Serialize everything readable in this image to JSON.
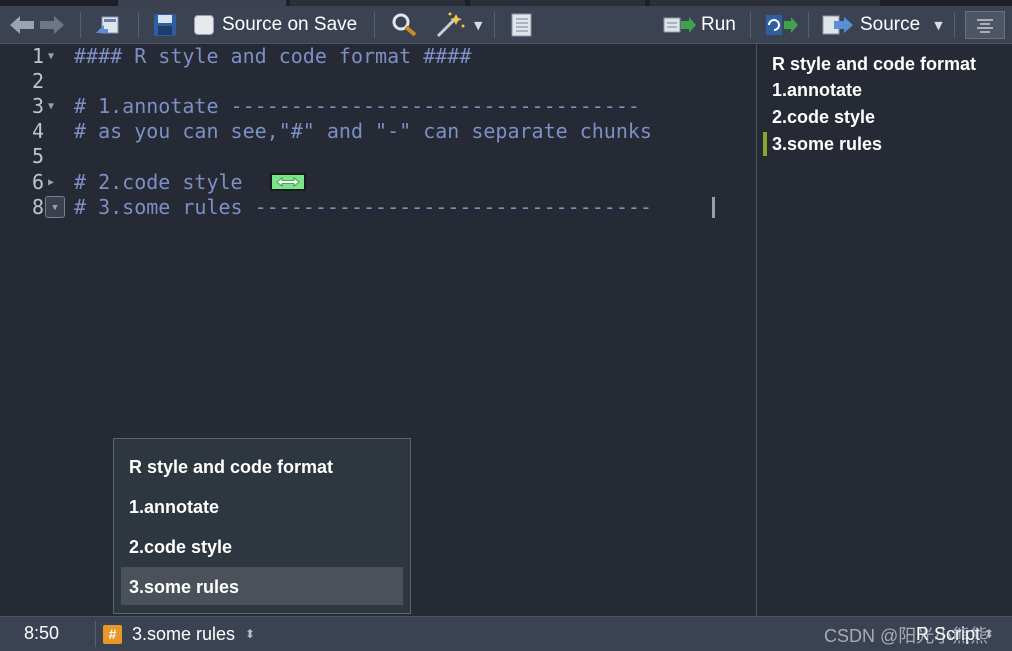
{
  "toolbar": {
    "back_icon": "arrow-left-icon",
    "forward_icon": "arrow-right-icon",
    "source_on_save_label": "Source on Save",
    "run_label": "Run",
    "source_label": "Source"
  },
  "editor": {
    "lines": [
      {
        "num": "1",
        "text": "#### R style and code format ####",
        "fold": "expanded"
      },
      {
        "num": "2",
        "text": "",
        "fold": ""
      },
      {
        "num": "3",
        "text": "# 1.annotate ----------------------------------",
        "fold": "expanded"
      },
      {
        "num": "4",
        "text": "# as you can see,\"#\" and \"-\" can separate chunks",
        "fold": ""
      },
      {
        "num": "5",
        "text": "",
        "fold": ""
      },
      {
        "num": "6",
        "text": "# 2.code style",
        "fold": "collapsed"
      },
      {
        "num": "8",
        "text": "# 3.some rules ---------------------------------",
        "fold": "active"
      }
    ]
  },
  "outline": {
    "items": [
      "R style and code format",
      "1.annotate",
      "2.code style",
      "3.some rules"
    ]
  },
  "popup": {
    "items": [
      "R style and code format",
      "1.annotate",
      "2.code style",
      "3.some rules"
    ],
    "selected_index": 3
  },
  "status": {
    "position": "8:50",
    "section_badge": "#",
    "section": "3.some rules",
    "file_type": "R Script",
    "watermark": "CSDN @阳光小熊熊"
  },
  "colors": {
    "editor_bg": "#262a35",
    "toolbar_bg": "#3b4252",
    "comment": "#7d8fc4",
    "line_number": "#c0c4cc",
    "popup_selected": "#4a5159",
    "outline_marker": "#8aa62c",
    "badge": "#e8982a"
  }
}
